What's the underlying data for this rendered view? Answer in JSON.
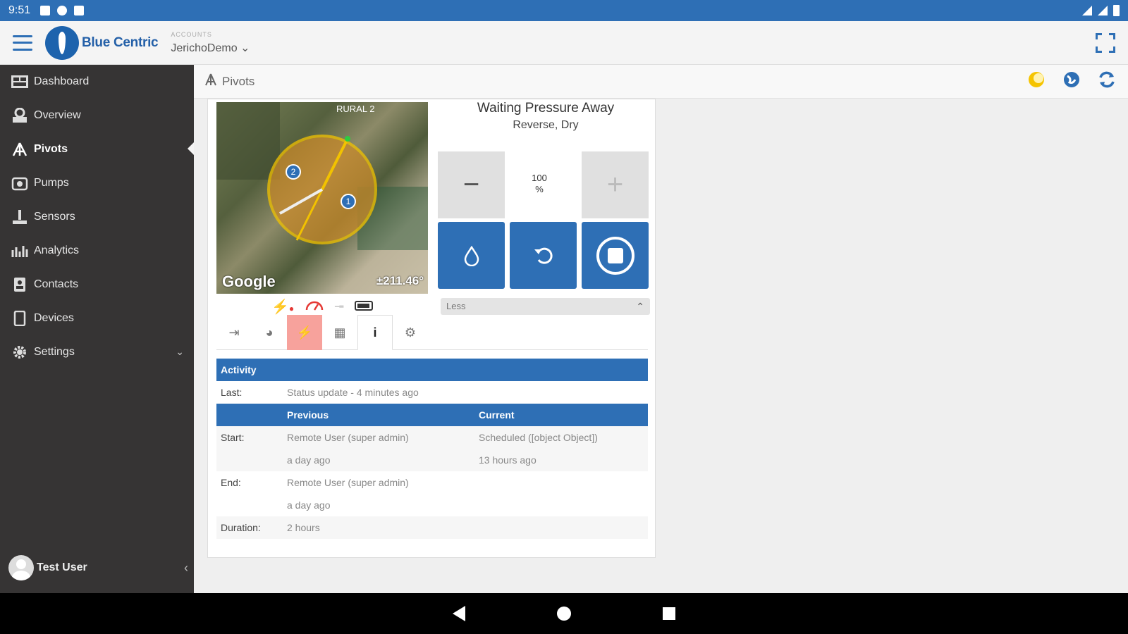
{
  "status_bar": {
    "time": "9:51"
  },
  "header": {
    "logo_text": "Blue Centric",
    "account_label": "ACCOUNTS",
    "account_value": "JerichoDemo ⌄"
  },
  "sidebar": {
    "items": [
      {
        "label": "Dashboard",
        "icon": "dashboard-icon"
      },
      {
        "label": "Overview",
        "icon": "overview-icon"
      },
      {
        "label": "Pivots",
        "icon": "pivot-icon"
      },
      {
        "label": "Pumps",
        "icon": "pump-icon"
      },
      {
        "label": "Sensors",
        "icon": "sensor-icon"
      },
      {
        "label": "Analytics",
        "icon": "analytics-icon"
      },
      {
        "label": "Contacts",
        "icon": "contacts-icon"
      },
      {
        "label": "Devices",
        "icon": "devices-icon"
      },
      {
        "label": "Settings",
        "icon": "gear-icon"
      }
    ],
    "user_name": "Test User"
  },
  "toolbar": {
    "title": "Pivots"
  },
  "pivot": {
    "map_label": "RURAL 2",
    "map_brand": "Google",
    "map_angle": "±211.46°",
    "state_title": "Waiting Pressure Away",
    "state_sub": "Reverse, Dry",
    "speed_value": "100",
    "speed_unit": "%",
    "less_label": "Less",
    "zone_1": "1",
    "zone_2": "2"
  },
  "activity": {
    "header": "Activity",
    "last_key": "Last:",
    "last_value": "Status update - 4 minutes ago",
    "col_previous": "Previous",
    "col_current": "Current",
    "start_key": "Start:",
    "start_prev": "Remote User (super admin)",
    "start_curr": "Scheduled ([object Object])",
    "start_prev_time": "a day ago",
    "start_curr_time": "13 hours ago",
    "end_key": "End:",
    "end_prev": "Remote User (super admin)",
    "end_prev_time": "a day ago",
    "duration_key": "Duration:",
    "duration_value": "2 hours"
  },
  "colors": {
    "primary": "#2e6fb5",
    "sidebar_bg": "#363434",
    "highlight_tab": "#f7a29c",
    "pivot_ring": "#f2c200"
  }
}
